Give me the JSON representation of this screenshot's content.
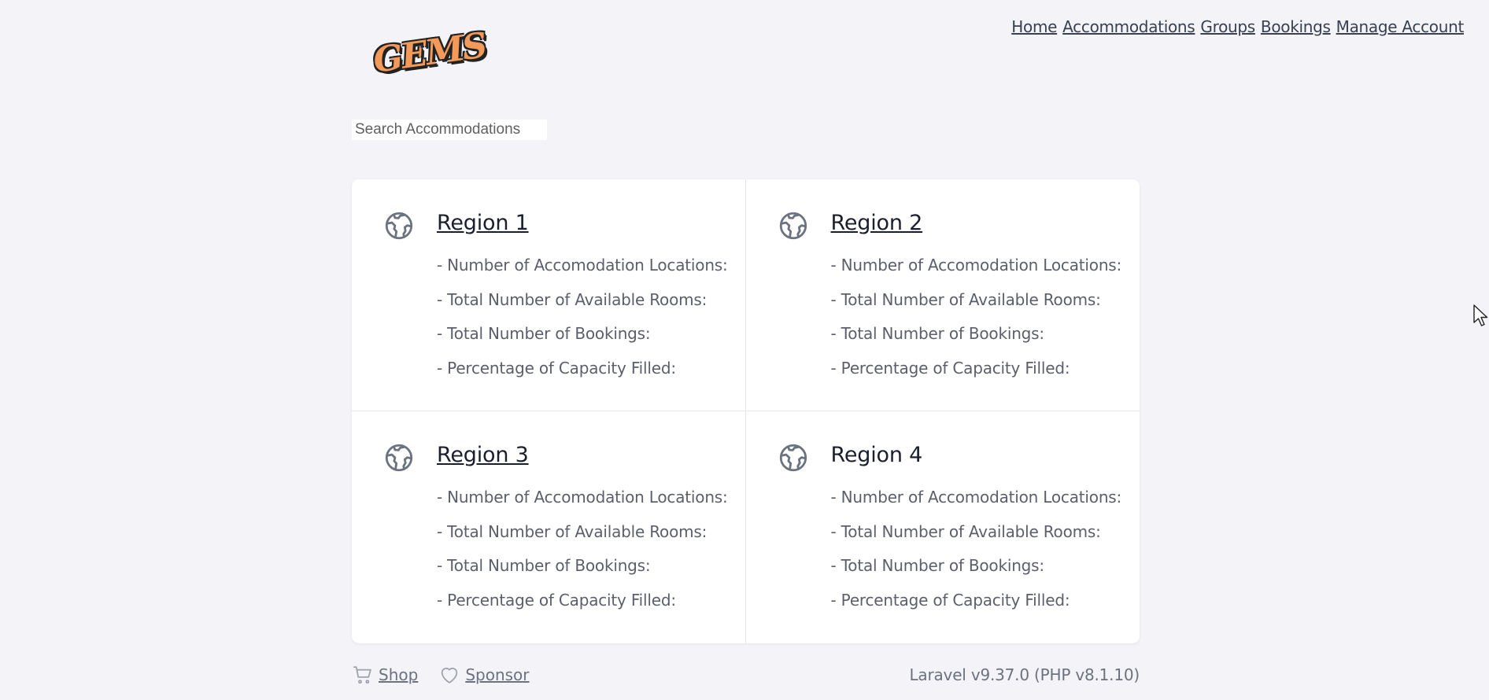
{
  "nav": {
    "items": [
      {
        "label": "Home"
      },
      {
        "label": "Accommodations"
      },
      {
        "label": "Groups"
      },
      {
        "label": "Bookings"
      },
      {
        "label": "Manage Account"
      }
    ]
  },
  "logo": {
    "text": "GEMS"
  },
  "search": {
    "placeholder": "Search Accommodations",
    "value": ""
  },
  "regions": [
    {
      "name": "Region 1",
      "icon": "globe-icon",
      "stats": [
        "- Number of Accomodation Locations:",
        "- Total Number of Available Rooms:",
        "- Total Number of Bookings:",
        "- Percentage of Capacity Filled:"
      ]
    },
    {
      "name": "Region 2",
      "icon": "globe-icon",
      "stats": [
        "- Number of Accomodation Locations:",
        "- Total Number of Available Rooms:",
        "- Total Number of Bookings:",
        "- Percentage of Capacity Filled:"
      ]
    },
    {
      "name": "Region 3",
      "icon": "globe-icon",
      "stats": [
        "- Number of Accomodation Locations:",
        "- Total Number of Available Rooms:",
        "- Total Number of Bookings:",
        "- Percentage of Capacity Filled:"
      ]
    },
    {
      "name": "Region 4",
      "icon": "globe-icon",
      "stats": [
        "- Number of Accomodation Locations:",
        "- Total Number of Available Rooms:",
        "- Total Number of Bookings:",
        "- Percentage of Capacity Filled:"
      ]
    }
  ],
  "footer": {
    "shop_label": "Shop",
    "sponsor_label": "Sponsor",
    "version": "Laravel v9.37.0 (PHP v8.1.10)"
  },
  "colors": {
    "background": "#f4f3f7",
    "logo": "#f39a5a",
    "text_muted": "#6b7280"
  }
}
